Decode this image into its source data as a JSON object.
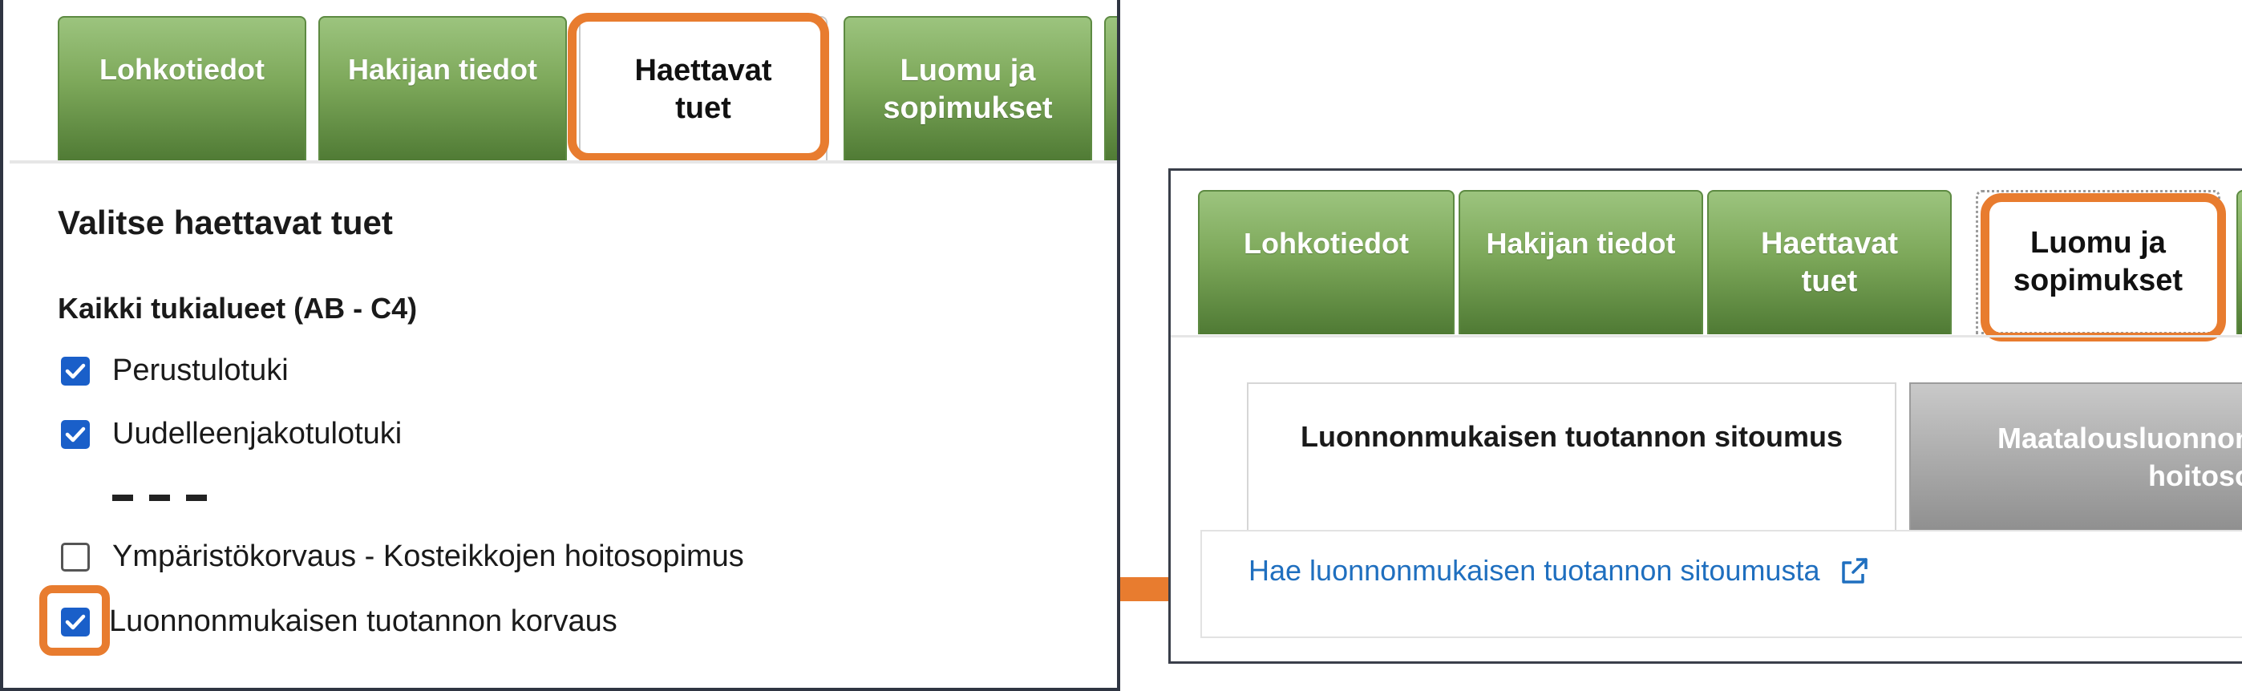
{
  "left": {
    "tabs": [
      {
        "label": "Lohkotiedot",
        "active": false
      },
      {
        "label": "Hakijan tiedot",
        "active": false
      },
      {
        "label": "Haettavat\ntuet",
        "active": true
      },
      {
        "label": "Luomu ja\nsopimukset",
        "active": false
      }
    ],
    "heading": "Valitse haettavat tuet",
    "subheading": "Kaikki tukialueet (AB - C4)",
    "checkboxes": [
      {
        "label": "Perustulotuki",
        "checked": true
      },
      {
        "label": "Uudelleenjakotulotuki",
        "checked": true
      },
      {
        "label": "Ympäristökorvaus - Kosteikkojen hoitosopimus",
        "checked": false
      },
      {
        "label": "Luonnonmukaisen tuotannon korvaus",
        "checked": true
      }
    ]
  },
  "right": {
    "tabs": [
      {
        "label": "Lohkotiedot",
        "active": false
      },
      {
        "label": "Hakijan tiedot",
        "active": false
      },
      {
        "label": "Haettavat\ntuet",
        "active": false
      },
      {
        "label": "Luomu ja\nsopimukset",
        "active": true
      }
    ],
    "subtabs": [
      {
        "label": "Luonnonmukaisen tuotannon sitoumus",
        "active": true
      },
      {
        "label": "Maatalousluonnon\nhoitoso",
        "active": false
      }
    ],
    "link": "Hae luonnonmukaisen tuotannon sitoumusta"
  },
  "colors": {
    "highlight": "#e87c2f",
    "tab_green": "#7da85a",
    "checkbox_blue": "#1a5fc9",
    "link_blue": "#1f6fbf"
  },
  "icons": [
    "checkmark-icon",
    "external-link-icon",
    "arrow-right-icon"
  ]
}
